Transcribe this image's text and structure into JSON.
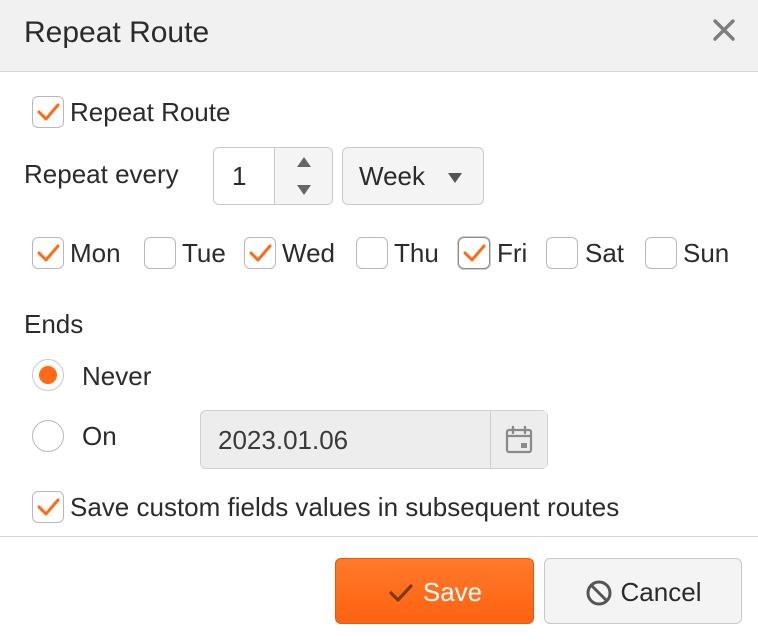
{
  "dialog": {
    "title": "Repeat Route",
    "close_icon": "close-icon"
  },
  "repeat_route": {
    "label": "Repeat Route",
    "checked": true
  },
  "repeat_every": {
    "label": "Repeat every",
    "value": "1",
    "unit": "Week"
  },
  "days": [
    {
      "label": "Mon",
      "checked": true
    },
    {
      "label": "Tue",
      "checked": false
    },
    {
      "label": "Wed",
      "checked": true
    },
    {
      "label": "Thu",
      "checked": false
    },
    {
      "label": "Fri",
      "checked": true
    },
    {
      "label": "Sat",
      "checked": false
    },
    {
      "label": "Sun",
      "checked": false
    }
  ],
  "ends": {
    "label": "Ends",
    "never_label": "Never",
    "on_label": "On",
    "selected": "never",
    "date": "2023.01.06",
    "date_icon": "calendar-icon"
  },
  "save_custom_fields": {
    "label": "Save custom fields values in subsequent routes",
    "checked": true
  },
  "footer": {
    "save_label": "Save",
    "save_icon": "checkmark-icon",
    "cancel_label": "Cancel",
    "cancel_icon": "ban-icon"
  },
  "colors": {
    "accent": "#ff6a13",
    "titlebar": "#f1f1f1"
  }
}
